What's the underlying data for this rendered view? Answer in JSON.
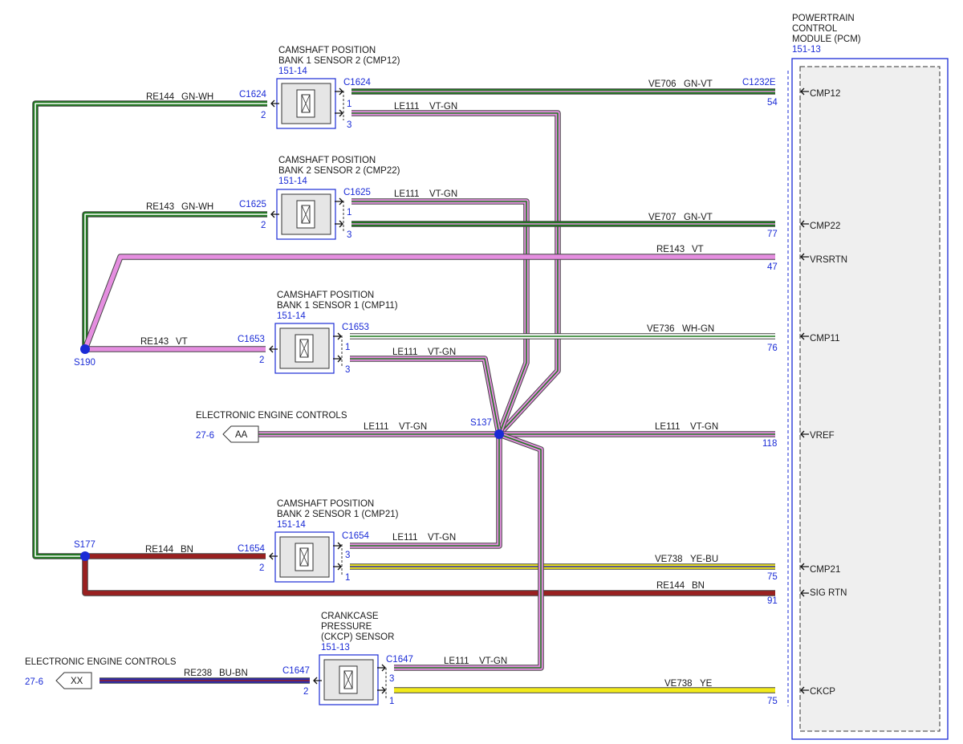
{
  "pcm": {
    "title": [
      "POWERTRAIN",
      "CONTROL",
      "MODULE (PCM)"
    ],
    "ref": "151-13",
    "connector": "C1232E",
    "terminals": [
      {
        "name": "CMP12",
        "pin": "54"
      },
      {
        "name": "CMP22",
        "pin": "77"
      },
      {
        "name": "VRSRTN",
        "pin": "47"
      },
      {
        "name": "CMP11",
        "pin": "76"
      },
      {
        "name": "VREF",
        "pin": "118"
      },
      {
        "name": "CMP21",
        "pin": "75"
      },
      {
        "name": "SIG RTN",
        "pin": "91"
      },
      {
        "name": "CKCP",
        "pin": "75"
      }
    ]
  },
  "sensors": [
    {
      "title": [
        "CAMSHAFT POSITION",
        "BANK 1 SENSOR 2 (CMP12)"
      ],
      "ref": "151-14",
      "connector": "C1624",
      "left_connector": "C1624",
      "left_pin": "2",
      "right_pins": [
        "1",
        "3"
      ]
    },
    {
      "title": [
        "CAMSHAFT POSITION",
        "BANK 2 SENSOR 2 (CMP22)"
      ],
      "ref": "151-14",
      "connector": "C1625",
      "left_connector": "C1625",
      "left_pin": "2",
      "right_pins": [
        "1",
        "3"
      ]
    },
    {
      "title": [
        "CAMSHAFT POSITION",
        "BANK 1 SENSOR 1 (CMP11)"
      ],
      "ref": "151-14",
      "connector": "C1653",
      "left_connector": "C1653",
      "left_pin": "2",
      "right_pins": [
        "1",
        "3"
      ]
    },
    {
      "title": [
        "CAMSHAFT POSITION",
        "BANK 2 SENSOR 1 (CMP21)"
      ],
      "ref": "151-14",
      "connector": "C1654",
      "left_connector": "C1654",
      "left_pin": "2",
      "right_pins": [
        "3",
        "1"
      ]
    },
    {
      "title": [
        "CRANKCASE",
        "PRESSURE",
        "(CKCP) SENSOR"
      ],
      "ref": "151-13",
      "connector": "C1647",
      "left_connector": "C1647",
      "left_pin": "2",
      "right_pins": [
        "3",
        "1"
      ]
    }
  ],
  "splices": [
    "S190",
    "S137",
    "S177"
  ],
  "off_page": [
    {
      "label": "ELECTRONIC ENGINE CONTROLS",
      "ref": "27-6",
      "tag": "AA"
    },
    {
      "label": "ELECTRONIC ENGINE CONTROLS",
      "ref": "27-6",
      "tag": "XX"
    }
  ],
  "circuits": [
    {
      "id": "re144_gnwh",
      "circuit": "RE144",
      "color_code": "GN-WH",
      "wire_color": "#1f7a1f",
      "stripe": "#ffffff"
    },
    {
      "id": "ve706",
      "circuit": "VE706",
      "color_code": "GN-VT",
      "wire_color": "#1f7a1f",
      "stripe": "#e58ee0"
    },
    {
      "id": "le111_a",
      "circuit": "LE111",
      "color_code": "VT-GN",
      "wire_color": "#e58ee0",
      "stripe": "#1f7a1f"
    },
    {
      "id": "re143_gnwh",
      "circuit": "RE143",
      "color_code": "GN-WH",
      "wire_color": "#1f7a1f",
      "stripe": "#ffffff"
    },
    {
      "id": "le111_b",
      "circuit": "LE111",
      "color_code": "VT-GN",
      "wire_color": "#e58ee0",
      "stripe": "#1f7a1f"
    },
    {
      "id": "ve707",
      "circuit": "VE707",
      "color_code": "GN-VT",
      "wire_color": "#1f7a1f",
      "stripe": "#e58ee0"
    },
    {
      "id": "re143_vt_pcm",
      "circuit": "RE143",
      "color_code": "VT",
      "wire_color": "#e58ee0",
      "stripe": ""
    },
    {
      "id": "ve736",
      "circuit": "VE736",
      "color_code": "WH-GN",
      "wire_color": "#ffffff",
      "stripe": "#1f7a1f"
    },
    {
      "id": "re143_vt",
      "circuit": "RE143",
      "color_code": "VT",
      "wire_color": "#e58ee0",
      "stripe": ""
    },
    {
      "id": "le111_c",
      "circuit": "LE111",
      "color_code": "VT-GN",
      "wire_color": "#e58ee0",
      "stripe": "#1f7a1f"
    },
    {
      "id": "le111_aa",
      "circuit": "LE111",
      "color_code": "VT-GN",
      "wire_color": "#e58ee0",
      "stripe": "#1f7a1f"
    },
    {
      "id": "le111_vref",
      "circuit": "LE111",
      "color_code": "VT-GN",
      "wire_color": "#e58ee0",
      "stripe": "#1f7a1f"
    },
    {
      "id": "re144_bn",
      "circuit": "RE144",
      "color_code": "BN",
      "wire_color": "#9a2020",
      "stripe": ""
    },
    {
      "id": "le111_d",
      "circuit": "LE111",
      "color_code": "VT-GN",
      "wire_color": "#e58ee0",
      "stripe": "#1f7a1f"
    },
    {
      "id": "ve738_yebu",
      "circuit": "VE738",
      "color_code": "YE-BU",
      "wire_color": "#f2ea1a",
      "stripe": "#2a2ab0"
    },
    {
      "id": "re144_bn_pcm",
      "circuit": "RE144",
      "color_code": "BN",
      "wire_color": "#9a2020",
      "stripe": ""
    },
    {
      "id": "re238",
      "circuit": "RE238",
      "color_code": "BU-BN",
      "wire_color": "#2a2ab0",
      "stripe": "#9a2020"
    },
    {
      "id": "le111_e",
      "circuit": "LE111",
      "color_code": "VT-GN",
      "wire_color": "#e58ee0",
      "stripe": "#1f7a1f"
    },
    {
      "id": "ve738_ye",
      "circuit": "VE738",
      "color_code": "YE",
      "wire_color": "#f2ea1a",
      "stripe": ""
    }
  ]
}
